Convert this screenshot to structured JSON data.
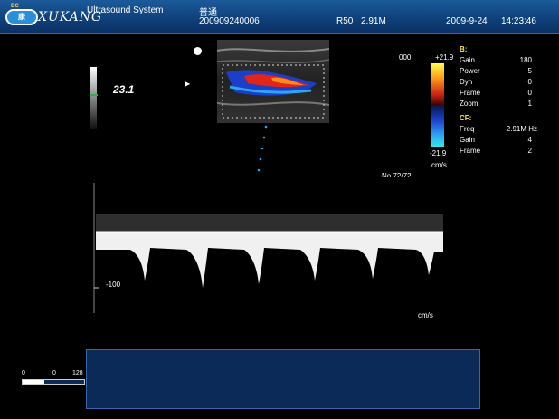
{
  "header": {
    "logo_cn": "康",
    "logo_tiny": "BC",
    "logo_text": "XUKANG",
    "system_title": "Ultrasound System",
    "mode": "普通",
    "patient_id": "200909240006",
    "probe": "R50",
    "frequency": "2.91M",
    "date": "2009-9-24",
    "time": "14:23:46"
  },
  "image": {
    "frame_num": "000",
    "depth_value": "23.1",
    "image_no": "No.72/72"
  },
  "color_scale": {
    "max": "+21.9",
    "min": "-21.9",
    "unit": "cm/s"
  },
  "params": {
    "b_section": "B:",
    "b_items": [
      {
        "name": "Gain",
        "value": "180"
      },
      {
        "name": "Power",
        "value": "5"
      },
      {
        "name": "Dyn",
        "value": "0"
      },
      {
        "name": "Frame",
        "value": "0"
      },
      {
        "name": "Zoom",
        "value": "1"
      }
    ],
    "cf_section": "CF:",
    "cf_items": [
      {
        "name": "Freq",
        "value": "2.91M Hz"
      },
      {
        "name": "Gain",
        "value": "4"
      },
      {
        "name": "Frame",
        "value": "2"
      }
    ]
  },
  "doppler": {
    "scale_label": "-100",
    "unit": "cm/s"
  },
  "bottom_scale": {
    "left": "0",
    "mid": "0",
    "right": "128",
    "level": 0.35
  }
}
